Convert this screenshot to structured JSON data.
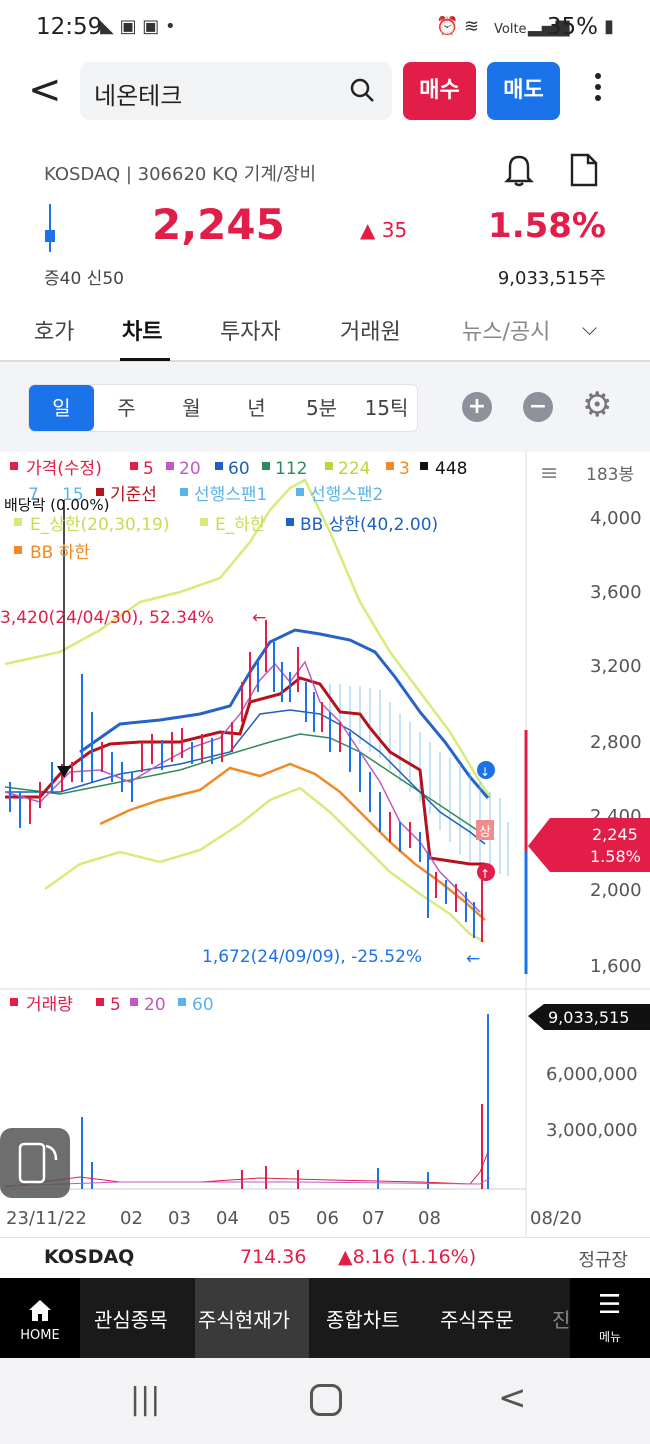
{
  "status_bar": {
    "time": "12:59",
    "battery": "35%",
    "network": "Volte"
  },
  "header": {
    "search_text": "네온테크",
    "buy_label": "매수",
    "sell_label": "매도"
  },
  "stock": {
    "market_info": "KOSDAQ | 306620 KQ 기계/장비",
    "price": "2,245",
    "change": "35",
    "change_pct": "1.58%",
    "margin_info": "증40  신50",
    "volume": "9,033,515주"
  },
  "tabs": [
    "호가",
    "차트",
    "투자자",
    "거래원",
    "뉴스/공시"
  ],
  "active_tab": "차트",
  "periods": [
    "일",
    "주",
    "월",
    "년",
    "5분",
    "15틱"
  ],
  "active_period": "일",
  "chart_legend": {
    "line1": [
      "가격(수정)",
      "5",
      "20",
      "60",
      "112",
      "224",
      "3",
      "448"
    ],
    "line2": [
      "7",
      "15",
      "기준선",
      "선행스팬1",
      "선행스팬2"
    ],
    "line3": [
      "E_상한(20,30,19)",
      "E_하한",
      "BB 상한(40,2.00)"
    ],
    "line4": [
      "BB 하한"
    ],
    "bars_count": "183봉",
    "dividend_label": "배당락 (0.00%)",
    "high_annotation": "3,420(24/04/30), 52.34%",
    "low_annotation": "1,672(24/09/09), -25.52%",
    "price_box": "2,245",
    "price_box_pct": "1.58%",
    "upper_marker": "상",
    "volume_legend": [
      "거래량",
      "5",
      "20",
      "60"
    ],
    "volume_box": "9,033,515"
  },
  "chart_data": {
    "type": "line",
    "x": [
      "23/11/22",
      "02",
      "03",
      "04",
      "05",
      "06",
      "07",
      "08",
      "08/20"
    ],
    "price_axis": [
      "4,000",
      "3,600",
      "3,200",
      "2,800",
      "2,400",
      "2,000",
      "1,600"
    ],
    "volume_axis": [
      "6,000,000",
      "3,000,000"
    ],
    "series": [
      {
        "name": "가격(수정)",
        "values": [
          2300,
          2250,
          2400,
          2500,
          2450,
          2600,
          2750,
          3300,
          3000,
          2800,
          2500,
          2200,
          2050,
          1800,
          2245
        ]
      }
    ],
    "high": 3420,
    "low": 1672
  },
  "market_ticker": {
    "name": "KOSDAQ",
    "value": "714.36",
    "change": "8.16 (1.16%)",
    "session": "정규장"
  },
  "bottom_nav": {
    "home": "HOME",
    "items": [
      "관심종목",
      "주식현재가",
      "종합차트",
      "주식주문",
      "진"
    ],
    "menu": "메뉴"
  },
  "colors": {
    "up": "#e11d48",
    "down": "#1a73e8"
  }
}
